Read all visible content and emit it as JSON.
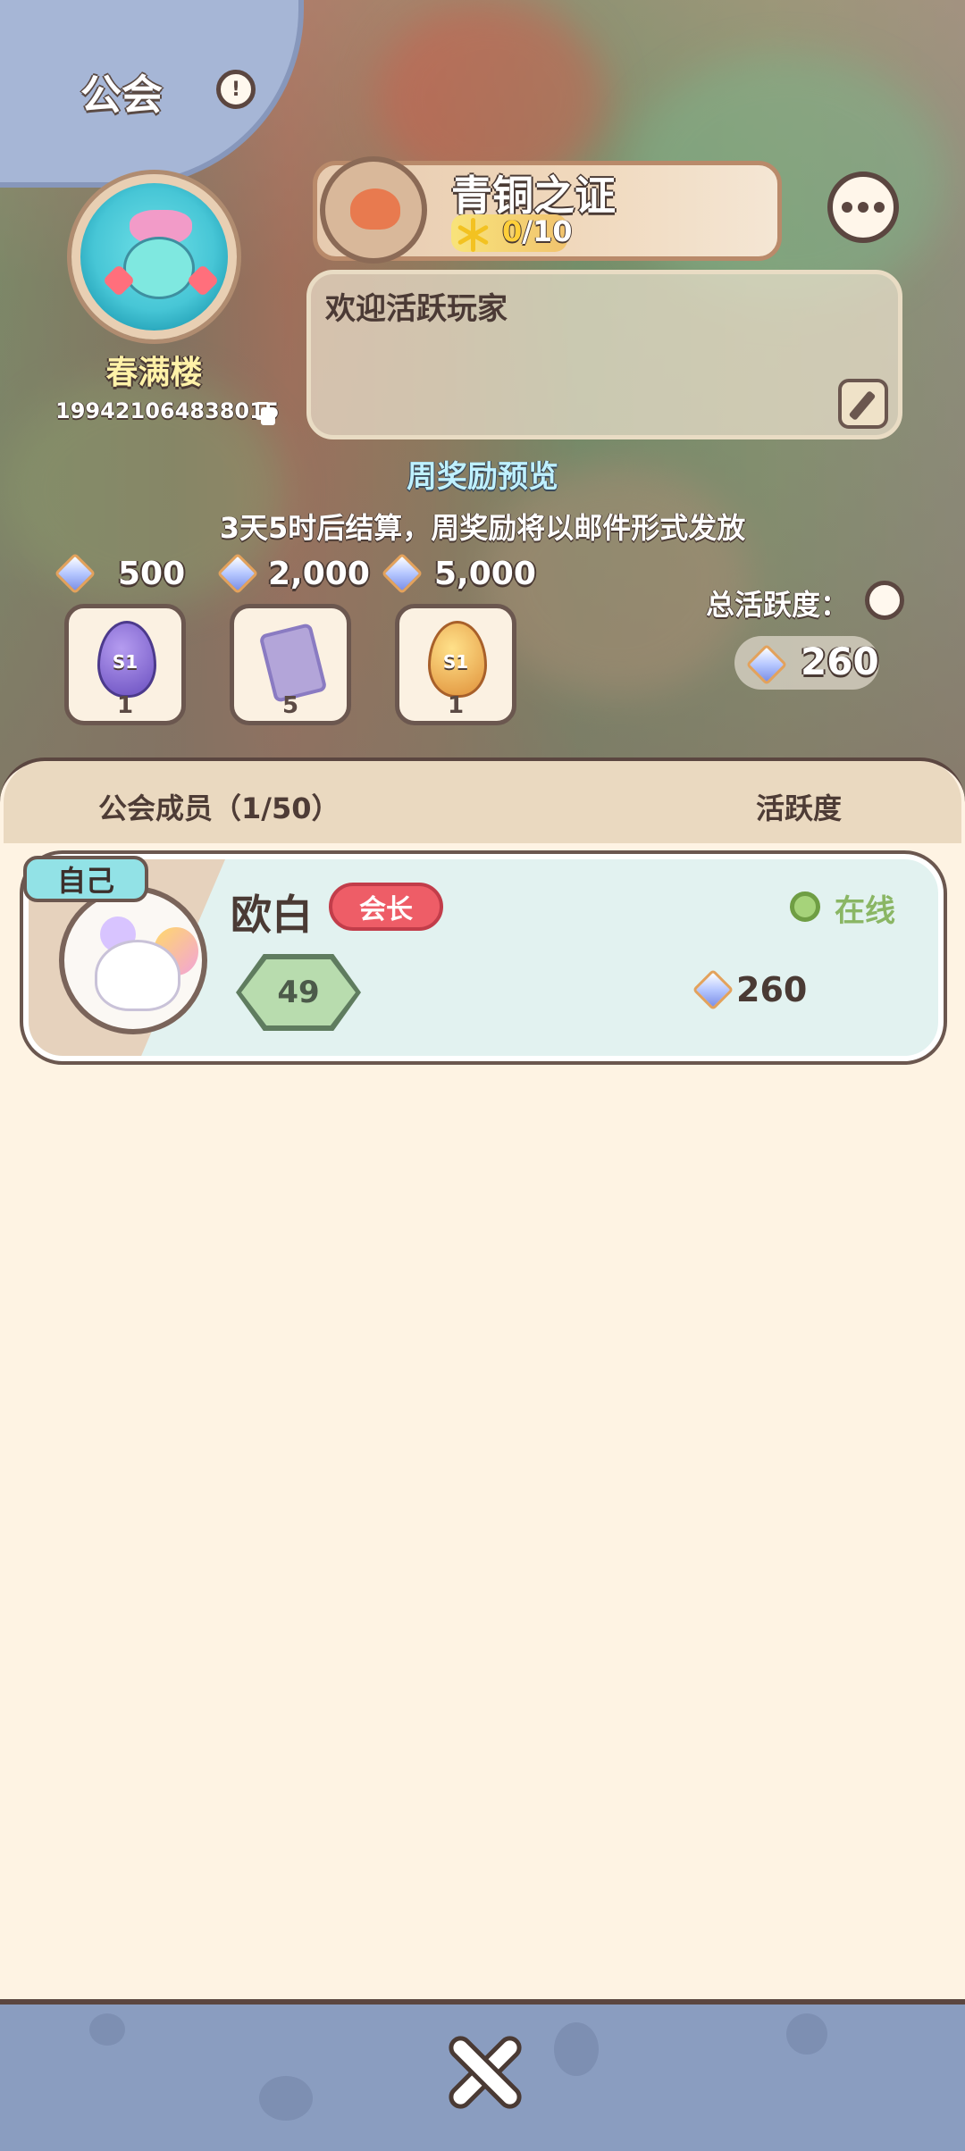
{
  "header": {
    "title": "公会",
    "info_icon": "info-icon"
  },
  "guild": {
    "name": "春满楼",
    "id": "199421064838015",
    "emblem_icon": "guild-emblem-icon",
    "copy_icon": "copy-icon"
  },
  "rank": {
    "title": "青铜之证",
    "progress_current": "0",
    "progress_total": "/10",
    "progress_fraction": 0.0,
    "icon": "frog-badge-icon"
  },
  "more_icon": "more-icon",
  "notice": {
    "text": "欢迎活跃玩家",
    "edit_icon": "edit-icon"
  },
  "weekly": {
    "title": "周奖励预览",
    "subtitle": "3天5时后结算，周奖励将以邮件形式发放",
    "tiers": [
      {
        "threshold": "500",
        "reward_icon": "purple-egg-icon",
        "reward_label": "S1",
        "quantity": "1"
      },
      {
        "threshold": "2,000",
        "reward_icon": "card-icon",
        "reward_label": "",
        "quantity": "5"
      },
      {
        "threshold": "5,000",
        "reward_icon": "gold-egg-icon",
        "reward_label": "S1",
        "quantity": "1"
      }
    ]
  },
  "total_activity": {
    "label": "总活跃度：",
    "value": "260",
    "info_icon": "info-icon"
  },
  "members": {
    "header_label": "公会成员（1/50）",
    "activity_label": "活跃度",
    "rows": [
      {
        "self_tag": "自己",
        "name": "欧白",
        "role": "会长",
        "status": "在线",
        "level": "49",
        "activity": "260",
        "avatar_icon": "cat-avatar-icon"
      }
    ]
  },
  "colors": {
    "panel_bg": "#fef3e3",
    "row_bg": "#e2f2f0",
    "role_badge": "#ee5d67",
    "online": "#8ab664",
    "bottom_bar": "#8a9dc0"
  },
  "close_icon": "close-icon"
}
